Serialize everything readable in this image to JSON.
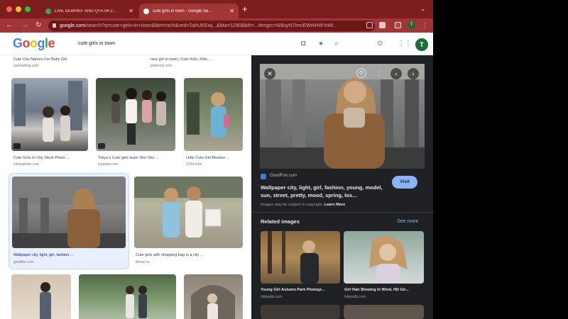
{
  "browser": {
    "tabs": [
      {
        "label": "LIVE DEBRIEF AND Q+A 04-2...",
        "favicon_color": "#34a853"
      },
      {
        "label": "cute girls in town - Google Se...",
        "favicon_color": "#e8eaed"
      }
    ],
    "new_tab_glyph": "+",
    "url_domain": "google.com",
    "url_rest": "/search?q=cute+girls+in+town&tbm=isch&ved=2ahUKEwj...&biw=1280&bih=...#imgrc=W8uyN7imcEWrkHWYoM...",
    "profile_initial": "T",
    "accent": "#a23636"
  },
  "header": {
    "logo_letters": [
      "G",
      "o",
      "o",
      "g",
      "l",
      "e"
    ],
    "logo_colors": [
      "#4285f4",
      "#ea4335",
      "#fbbc05",
      "#4285f4",
      "#34a853",
      "#ea4335"
    ],
    "query": "cute girls in town",
    "avatar_initial": "T"
  },
  "results": {
    "row0": [
      {
        "caption": "Cute City Names For Baby Girl",
        "source": "namesblog.com"
      },
      {
        "caption": "new girl in town | Cute Kids, Kids ...",
        "source": "pinterest.com"
      }
    ],
    "row1": [
      {
        "caption": "Cute Girls In City Stock Photo ...",
        "source": "istockphoto.com"
      },
      {
        "caption": "Tokyo's Cute girls team Stor Okv ...",
        "source": "youtube.com"
      },
      {
        "caption": "Little Cute Girl Blueber ...",
        "source": "123rf.com"
      }
    ],
    "row2": [
      {
        "caption": "Wallpaper city, light, girl, fashion ...",
        "source": "goodfon.com"
      },
      {
        "caption": "Cute girls with shopping bag in a city ...",
        "source": "tlehan.ru"
      }
    ]
  },
  "panel": {
    "site": "GoodFon.com",
    "title": "Wallpaper city, light, girl, fashion, young, model, sun, street, pretty, mood, spring, los...",
    "visit_label": "Visit",
    "copyright_text": "Images may be subject to copyright.",
    "learn_more": "Learn More",
    "related_heading": "Related images",
    "see_more": "See more",
    "related": [
      {
        "caption": "Young Girl Autumn Park Photogr...",
        "source": "hdqwalls.com"
      },
      {
        "caption": "Girl Hair Blowing In Wind, HD Gir...",
        "source": "hdqwalls.com"
      }
    ]
  },
  "icons": {
    "close": "✕",
    "prev": "‹",
    "next": "›",
    "back": "←",
    "forward": "→",
    "reload": "↻"
  }
}
